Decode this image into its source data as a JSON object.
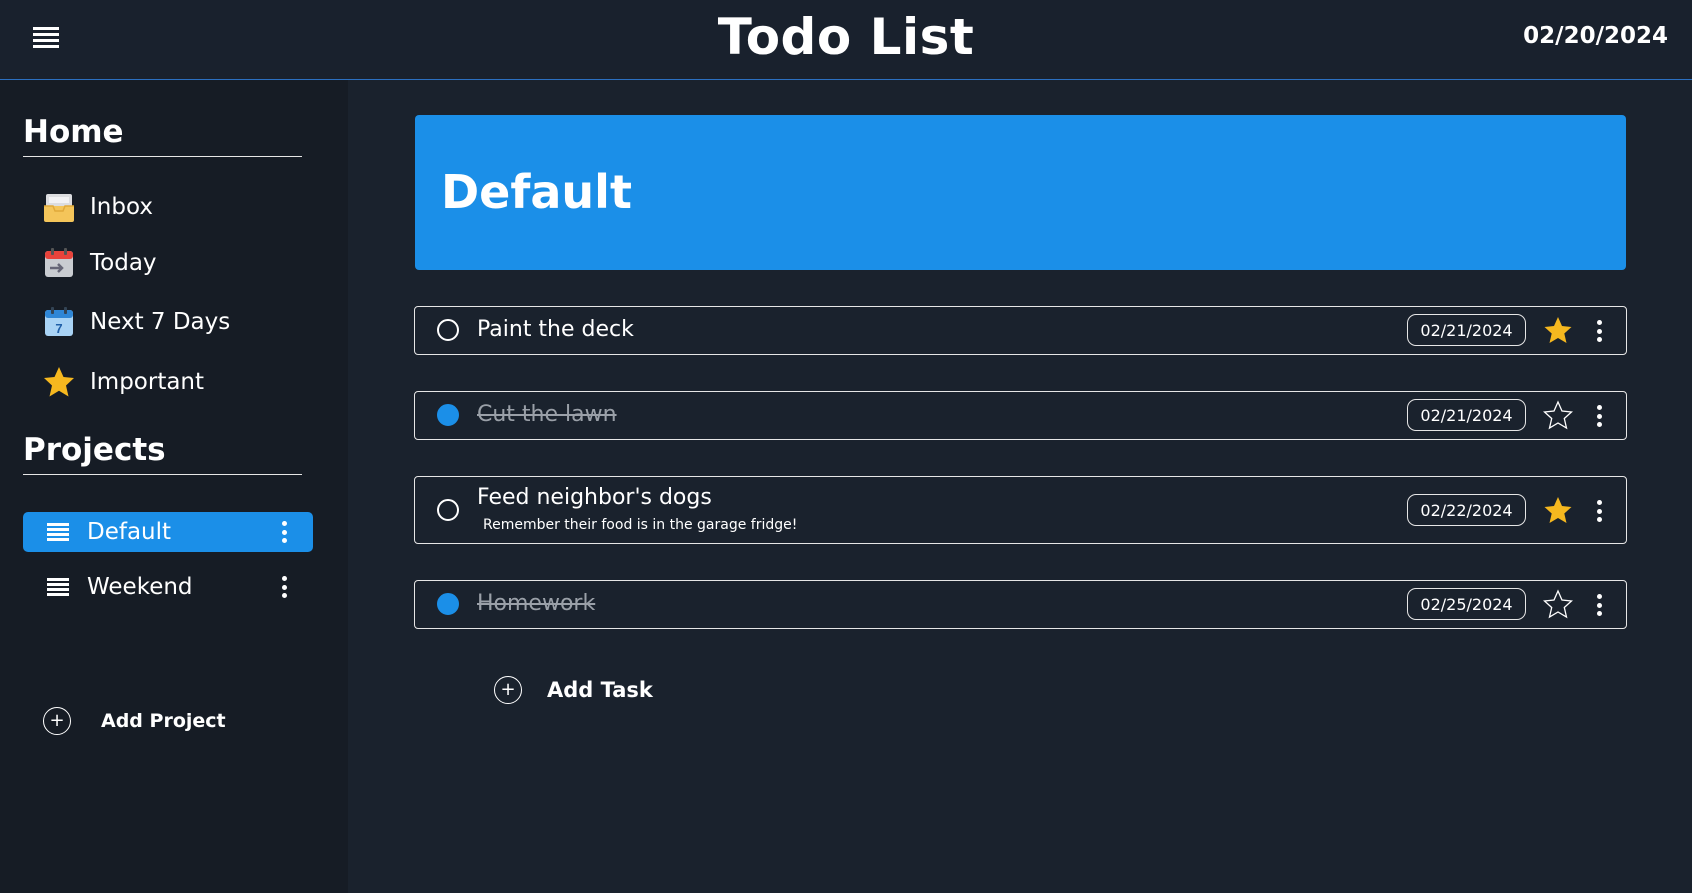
{
  "header": {
    "title": "Todo List",
    "date": "02/20/2024",
    "menu_icon": "hamburger-menu-icon"
  },
  "sidebar": {
    "home_title": "Home",
    "home_items": [
      {
        "label": "Inbox",
        "icon": "inbox-tray-icon"
      },
      {
        "label": "Today",
        "icon": "calendar-today-icon"
      },
      {
        "label": "Next 7 Days",
        "icon": "calendar-7-icon"
      },
      {
        "label": "Important",
        "icon": "star-icon"
      }
    ],
    "projects_title": "Projects",
    "projects": [
      {
        "label": "Default",
        "active": true
      },
      {
        "label": "Weekend",
        "active": false
      }
    ],
    "add_project_label": "Add Project"
  },
  "main": {
    "project_title": "Default",
    "tasks": [
      {
        "title": "Paint the deck",
        "note": "",
        "date": "02/21/2024",
        "done": false,
        "important": true
      },
      {
        "title": "Cut the lawn",
        "note": "",
        "date": "02/21/2024",
        "done": true,
        "important": false
      },
      {
        "title": "Feed neighbor's dogs",
        "note": "Remember their food is in the garage fridge!",
        "date": "02/22/2024",
        "done": false,
        "important": true
      },
      {
        "title": "Homework",
        "note": "",
        "date": "02/25/2024",
        "done": true,
        "important": false
      }
    ],
    "add_task_label": "Add Task"
  },
  "colors": {
    "background": "#1a222d",
    "sidebar": "#161c25",
    "accent": "#1b8fe8",
    "star": "#f6b81f"
  }
}
